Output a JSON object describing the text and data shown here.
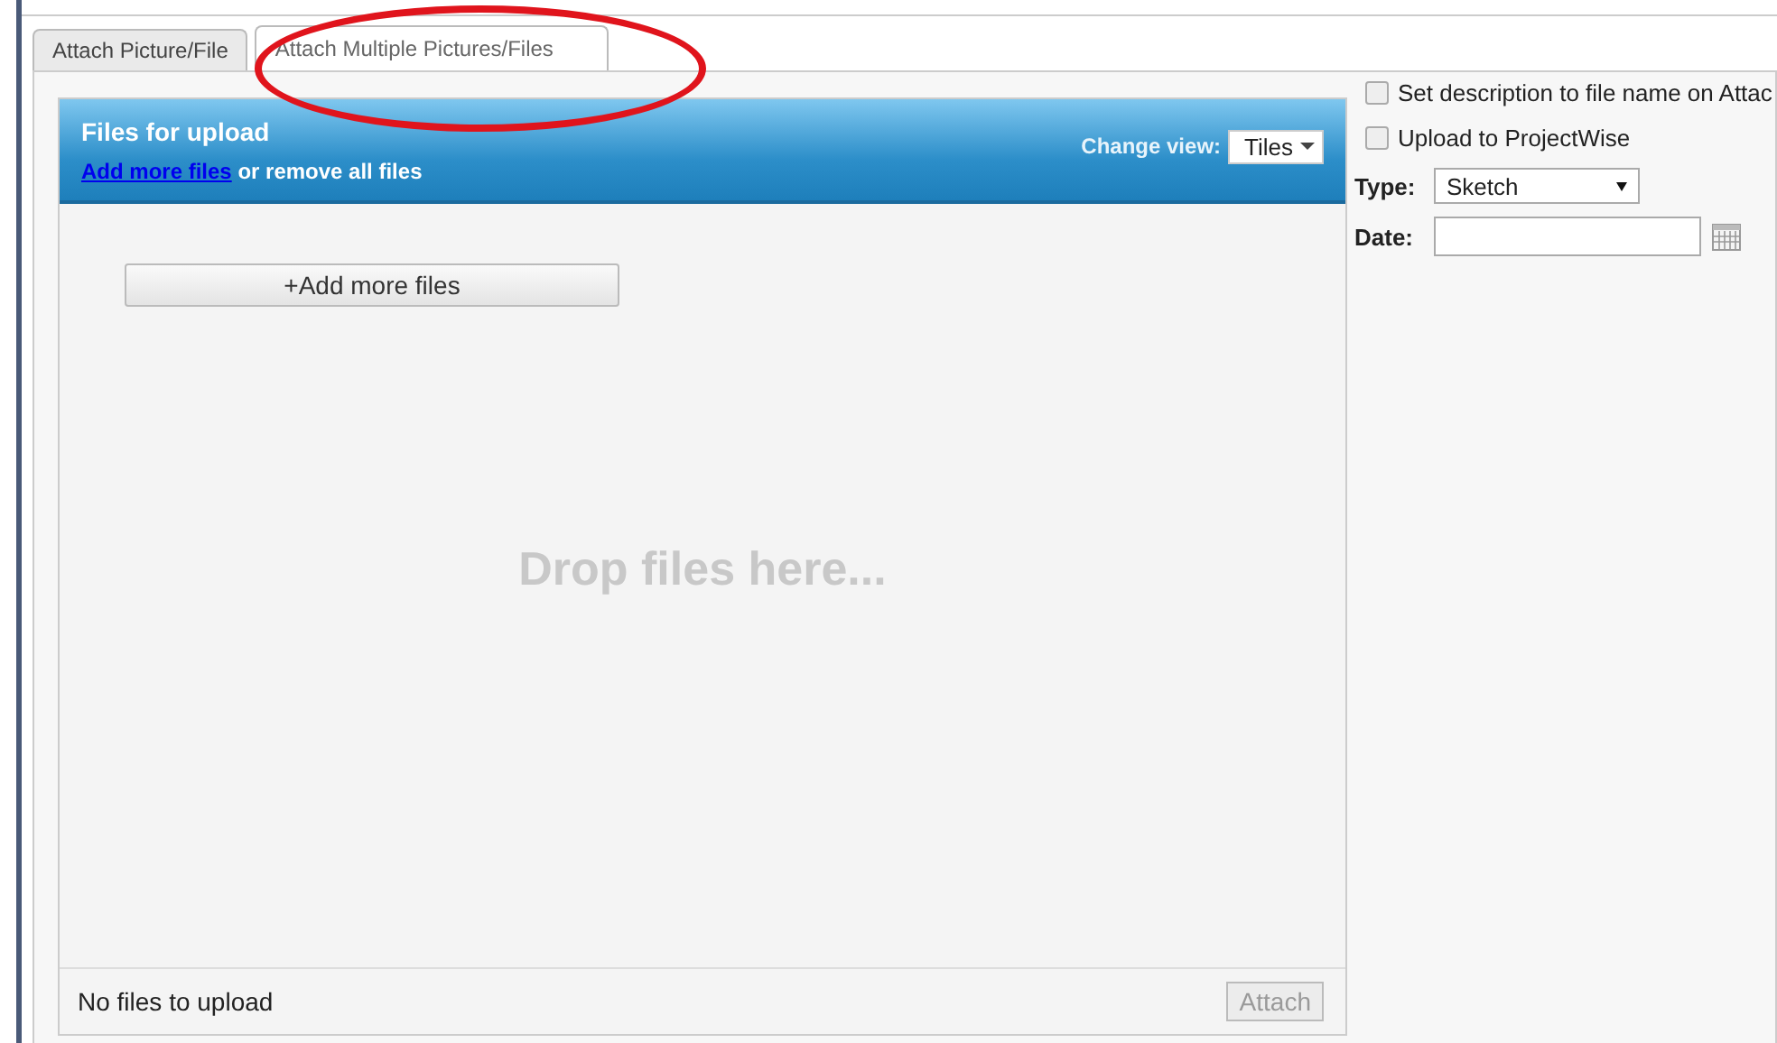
{
  "tabs": [
    {
      "label": "Attach Picture/File",
      "selected": false
    },
    {
      "label": "Attach Multiple Pictures/Files",
      "selected": true
    }
  ],
  "upload_panel": {
    "title": "Files for upload",
    "add_link": "Add more files",
    "remove_text": "or remove all files",
    "change_view_label": "Change view:",
    "view_select": "Tiles",
    "add_button": "+Add more files",
    "drop_hint": "Drop files here...",
    "status": "No files to upload",
    "attach_button": {
      "label": "Attach",
      "disabled": true
    }
  },
  "options": {
    "checkboxes": [
      {
        "label": "Set description to file name on Attac",
        "checked": false
      },
      {
        "label": "Upload to ProjectWise",
        "checked": false
      }
    ],
    "type_label": "Type:",
    "type_value": "Sketch",
    "date_label": "Date:"
  },
  "annotation": {
    "kind": "ellipse"
  }
}
